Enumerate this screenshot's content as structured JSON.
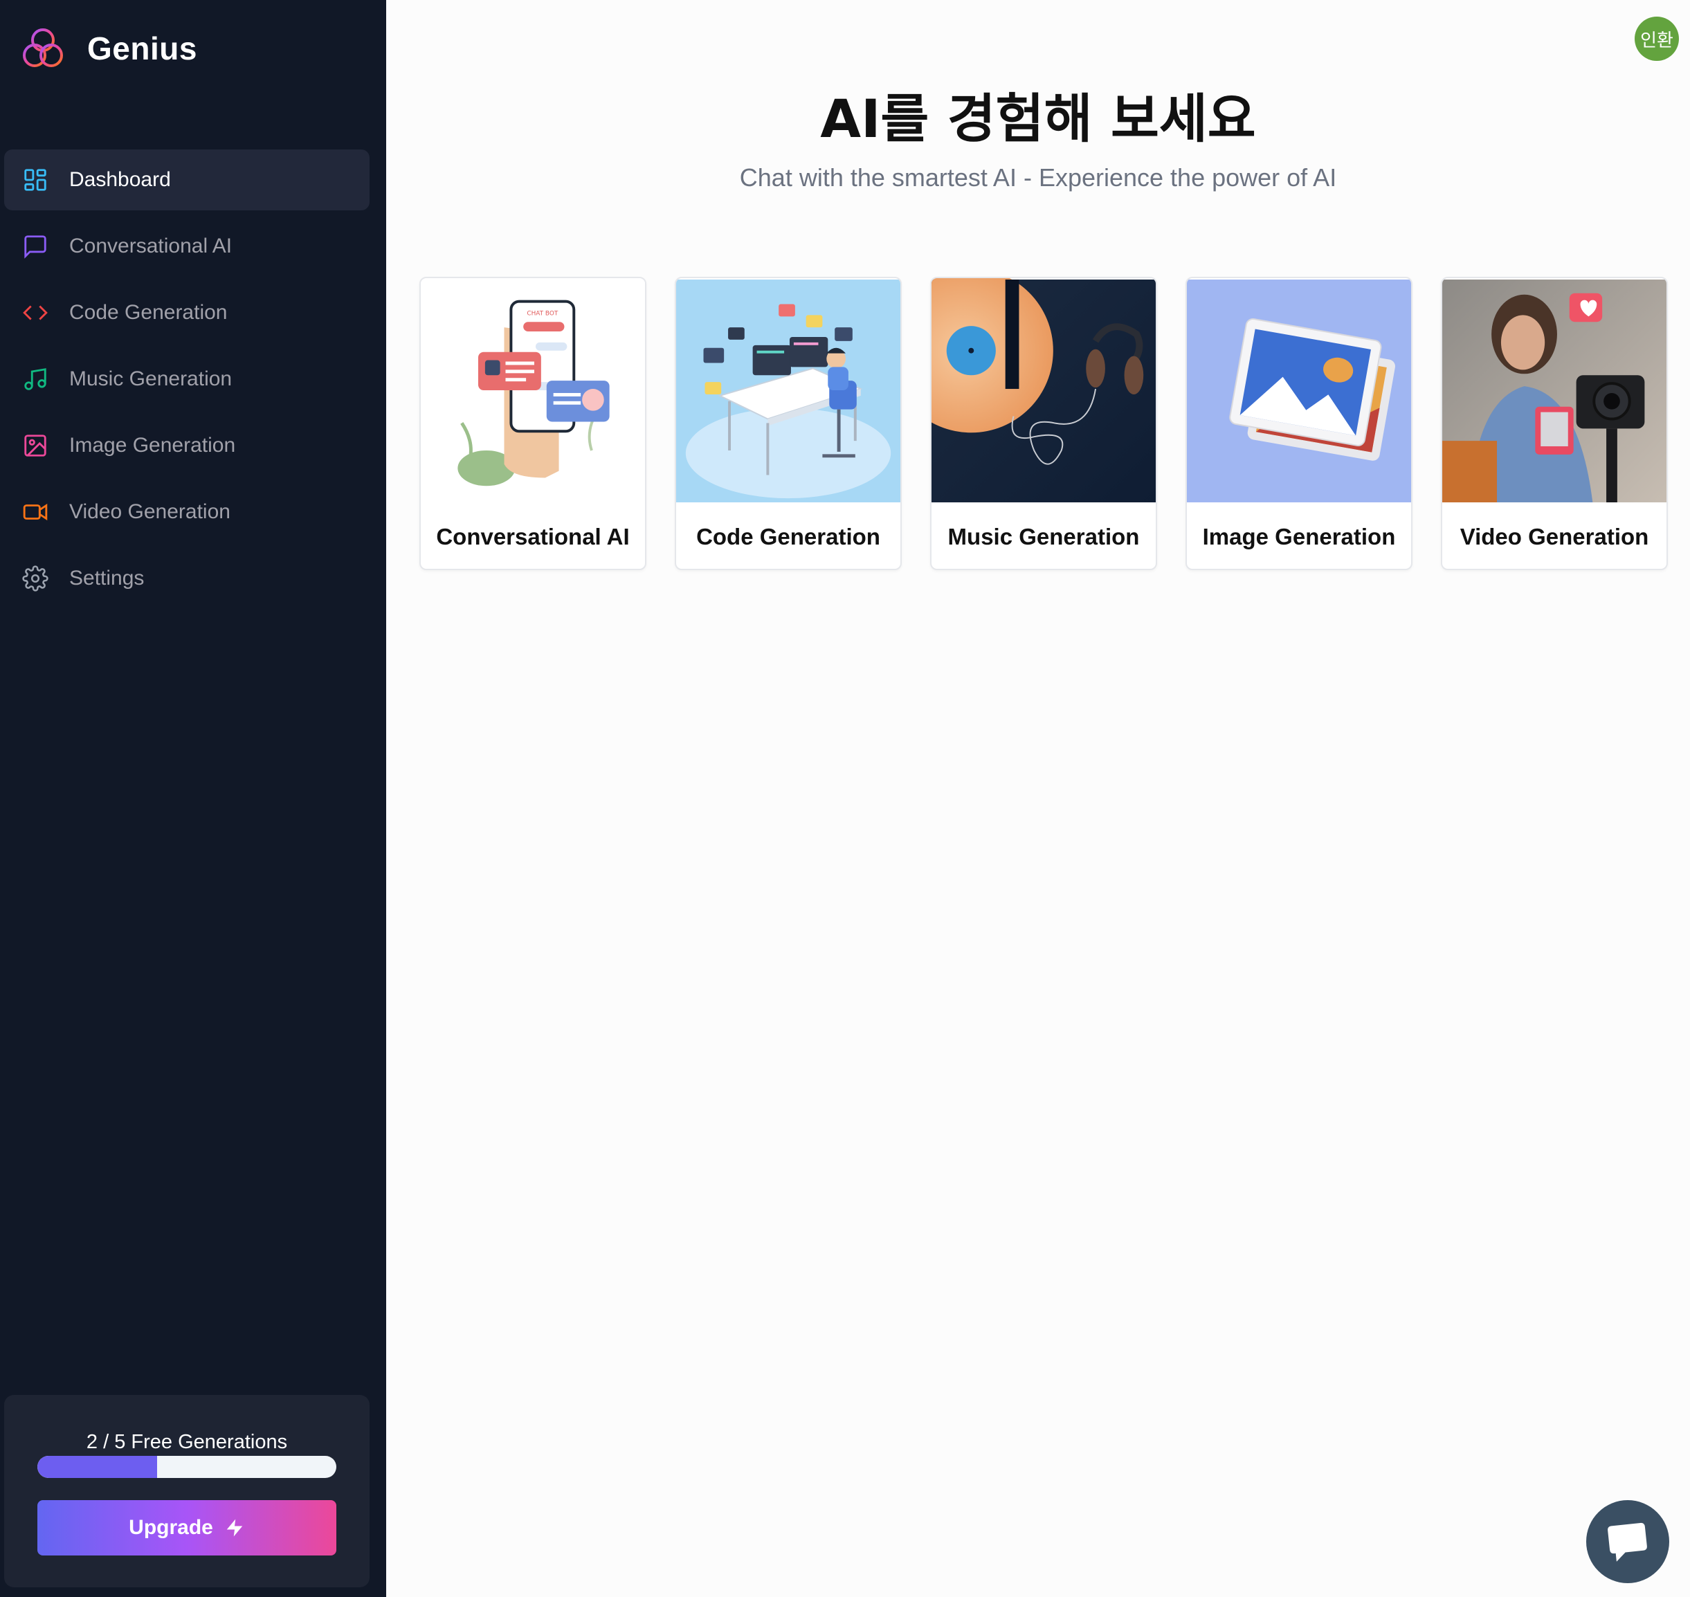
{
  "brand": {
    "name": "Genius"
  },
  "sidebar": {
    "items": [
      {
        "label": "Dashboard",
        "icon": "dashboard-icon",
        "color": "#38bdf8",
        "active": true
      },
      {
        "label": "Conversational AI",
        "icon": "message-square-icon",
        "color": "#8b5cf6"
      },
      {
        "label": "Code Generation",
        "icon": "code-icon",
        "color": "#ef4444"
      },
      {
        "label": "Music Generation",
        "icon": "music-icon",
        "color": "#10b981"
      },
      {
        "label": "Image Generation",
        "icon": "image-icon",
        "color": "#ec4899"
      },
      {
        "label": "Video Generation",
        "icon": "video-icon",
        "color": "#f97316"
      },
      {
        "label": "Settings",
        "icon": "gear-icon",
        "color": "#9ca3af"
      }
    ],
    "usage": {
      "text": "2 / 5 Free Generations",
      "used": 2,
      "limit": 5
    },
    "upgrade_label": "Upgrade"
  },
  "header": {
    "avatar_text": "인환",
    "avatar_color": "#63a33e"
  },
  "main": {
    "title": "AI를 경험해 보세요",
    "subtitle": "Chat with the smartest AI - Experience the power of AI",
    "cards": [
      {
        "label": "Conversational AI",
        "image": "chatbot-phone-illustration"
      },
      {
        "label": "Code Generation",
        "image": "programmer-desk-illustration"
      },
      {
        "label": "Music Generation",
        "image": "vinyl-headphones-photo"
      },
      {
        "label": "Image Generation",
        "image": "picture-stack-icon"
      },
      {
        "label": "Video Generation",
        "image": "video-blogger-photo"
      }
    ]
  },
  "colors": {
    "sidebar_bg": "#111827",
    "accent": "#6d5ef0",
    "upgrade_gradient": [
      "#6366f1",
      "#a855f7",
      "#ec4899"
    ]
  }
}
